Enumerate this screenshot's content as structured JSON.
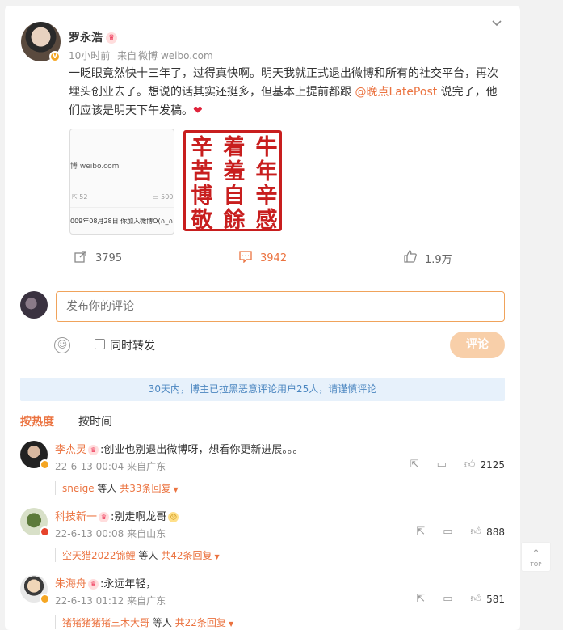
{
  "post": {
    "author": "罗永浩",
    "time": "10小时前",
    "source_prefix": "来自",
    "source": "微博 weibo.com",
    "text_before": "一眨眼竟然快十三年了，过得真快啊。明天我就正式退出微博和所有的社交平台，再次埋头创业去了。想说的话其实还挺多，但基本上提前都跟 ",
    "mention": "@晚点LatePost",
    "text_after": " 说完了，他们应该是明天下午发稿。",
    "heart": "❤",
    "thumb1": {
      "url_text": "博 weibo.com",
      "shares": "52",
      "comments": "500",
      "footer": "009年08月28日 你加入微博O(∩_∩)O"
    },
    "seal_cols": [
      "辛苦博敬",
      "着羞自餘",
      "牛年辛感"
    ],
    "actions": {
      "share_count": "3795",
      "comment_count": "3942",
      "like_count": "1.9万"
    }
  },
  "composer": {
    "placeholder": "发布你的评论",
    "repost_label": "同时转发",
    "submit_label": "评论"
  },
  "notice": "30天内，博主已拉黑恶意评论用户25人，请谨慎评论",
  "sort": {
    "hot": "按热度",
    "time": "按时间"
  },
  "comments": [
    {
      "name": "李杰灵",
      "text": ":创业也别退出微博呀，想看你更新进展。。。",
      "time": "22-6-13 00:04",
      "location": "来自广东",
      "likes": "2125",
      "reply_by": "sneige",
      "reply_mid": " 等人 ",
      "reply_count": "共33条回复"
    },
    {
      "name": "科技新一",
      "text": ":别走啊龙哥",
      "time": "22-6-13 00:08",
      "location": "来自山东",
      "likes": "888",
      "reply_by": "空天猎2022锦鲤",
      "reply_mid": " 等人 ",
      "reply_count": "共42条回复"
    },
    {
      "name": "朱海舟",
      "text": ":永远年轻，",
      "time": "22-6-13 01:12",
      "location": "来自广东",
      "likes": "581",
      "reply_by": "猪猪猪猪猪三木大哥",
      "reply_mid": " 等人 ",
      "reply_count": "共22条回复"
    }
  ],
  "totop": "TOP",
  "colors": {
    "accent": "#eb7340",
    "notice_bg": "#e7f1fb",
    "notice_text": "#4b86c0",
    "seal_red": "#c81e1e"
  }
}
